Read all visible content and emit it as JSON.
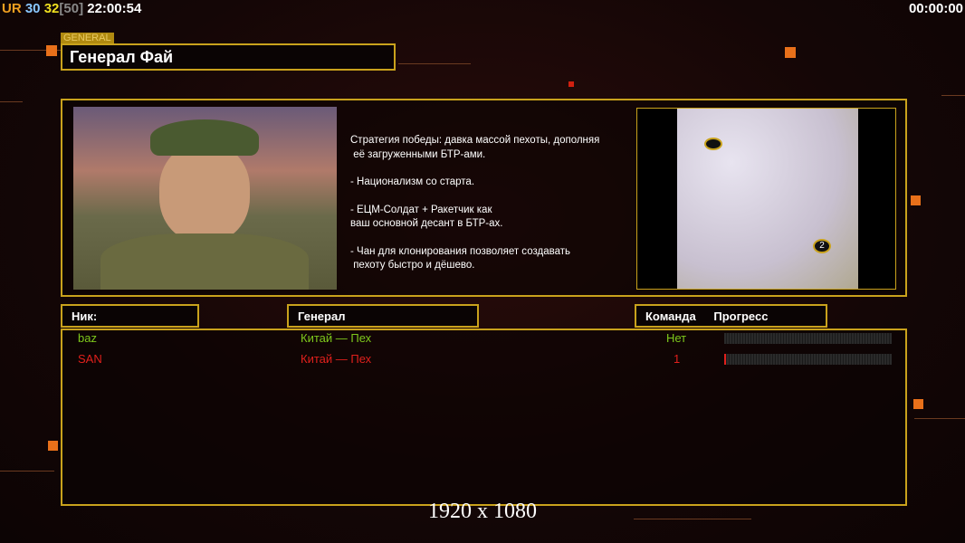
{
  "hud": {
    "ur": "UR",
    "v1": "30",
    "v2": "32",
    "v3": "[50]",
    "clock": "22:00:54",
    "timer": "00:00:00"
  },
  "general": {
    "tag": "GENERAL",
    "name": "Генерал Фай"
  },
  "description": [
    "Стратегия победы: давка массой пехоты, дополняя",
    " её загруженными БТР-ами.",
    "",
    "- Национализм со старта.",
    "",
    "- ЕЦМ-Солдат + Ракетчик как",
    "ваш основной десант в БТР-ах.",
    "",
    "- Чан для клонирования позволяет создавать",
    " пехоту быстро и дёшево."
  ],
  "columns": {
    "nick": "Ник:",
    "general": "Генерал",
    "team": "Команда",
    "progress": "Прогресс"
  },
  "players": [
    {
      "nick": "baz",
      "general": "Китай — Пех",
      "team": "Нет",
      "progress": 0,
      "color": "#7ec81c"
    },
    {
      "nick": "SAN",
      "general": "Китай — Пех",
      "team": "1",
      "progress": 0.01,
      "color": "#e0201c"
    }
  ],
  "map": {
    "marker": "2"
  },
  "resolution": "1920 x 1080"
}
